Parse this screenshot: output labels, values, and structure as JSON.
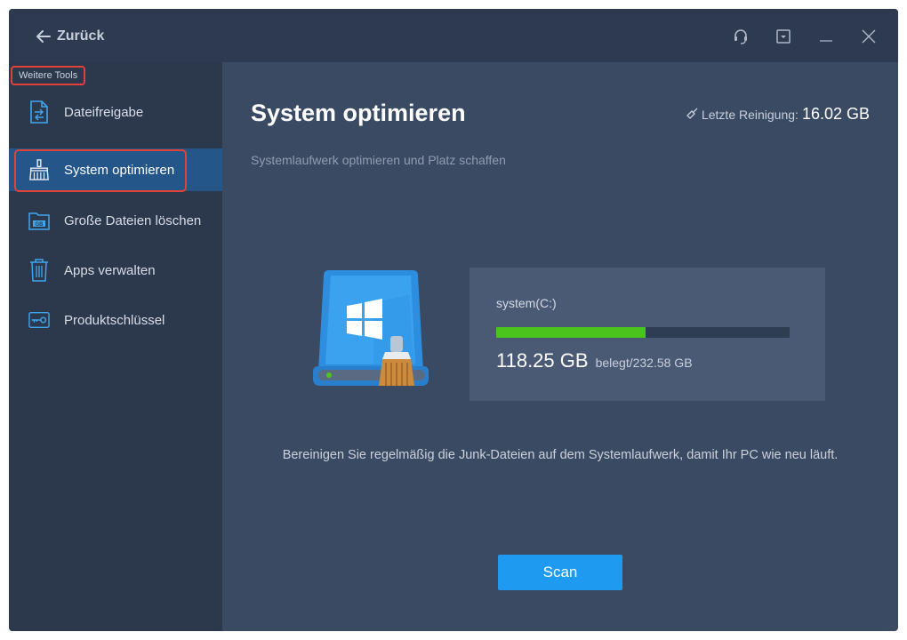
{
  "titlebar": {
    "back_label": "Zurück",
    "icons": [
      "support-icon",
      "minimize-to-tray-icon",
      "minimize-icon",
      "close-icon"
    ]
  },
  "sidebar": {
    "section_label": "Weitere Tools",
    "items": [
      {
        "label": "Dateifreigabe",
        "icon": "file-share-icon",
        "active": false
      },
      {
        "label": "System optimieren",
        "icon": "broom-icon",
        "active": true
      },
      {
        "label": "Große Dateien löschen",
        "icon": "large-files-icon",
        "active": false
      },
      {
        "label": "Apps verwalten",
        "icon": "trash-icon",
        "active": false
      },
      {
        "label": "Produktschlüssel",
        "icon": "key-icon",
        "active": false
      }
    ]
  },
  "main": {
    "title": "System optimieren",
    "last_clean_label": "Letzte Reinigung:",
    "last_clean_value": "16.02 GB",
    "subtitle": "Systemlaufwerk optimieren und Platz schaffen",
    "drive": {
      "name": "system(C:)",
      "used": "118.25 GB",
      "total": "belegt/232.58 GB",
      "used_fraction": 0.508
    },
    "hint": "Bereinigen Sie regelmäßig die Junk-Dateien auf dem Systemlaufwerk, damit Ihr PC wie neu läuft.",
    "scan_label": "Scan"
  },
  "colors": {
    "titlebar_bg": "#2e3a4f",
    "sidebar_bg": "#2c384c",
    "main_bg": "#3b4a63",
    "active_item_bg": "#24568a",
    "highlight_border": "#e2413a",
    "progress_fill": "#4cc41e",
    "scan_button": "#1e9bf0"
  }
}
